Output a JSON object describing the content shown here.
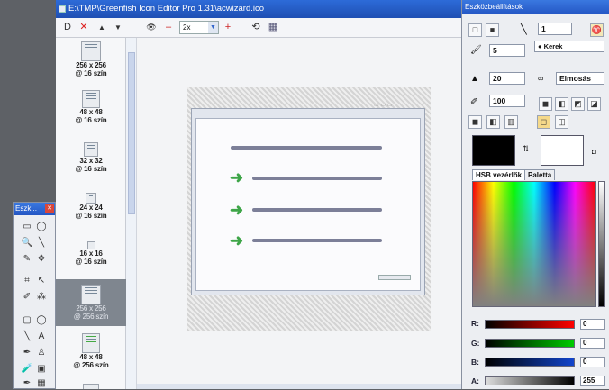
{
  "window": {
    "title": "E:\\TMP\\Greenfish Icon Editor Pro 1.31\\acwizard.ico"
  },
  "toolbar": {
    "new": "D",
    "close": "✕",
    "up": "▲",
    "down": "▼",
    "eye": "👁",
    "minus": "–",
    "zoom": "2x",
    "plus": "+",
    "icon_a": "⟲",
    "icon_b": "▦"
  },
  "thumbnails": [
    {
      "size": "256 x 256",
      "colors": "@ 16 szín"
    },
    {
      "size": "48 x 48",
      "colors": "@ 16 szín"
    },
    {
      "size": "32 x 32",
      "colors": "@ 16 szín"
    },
    {
      "size": "24 x 24",
      "colors": "@ 16 szín"
    },
    {
      "size": "16 x 16",
      "colors": "@ 16 szín"
    },
    {
      "size": "256 x 256",
      "colors": "@ 256 szín"
    },
    {
      "size": "48 x 48",
      "colors": "@ 256 szín"
    }
  ],
  "tools": {
    "title": "Eszk...",
    "close": "✕",
    "icons": [
      "▭",
      "◯",
      "🔍",
      "╲",
      "✎",
      "✥",
      "⌗",
      "↖",
      "✐",
      "⁂",
      "▢",
      "◯",
      "╲",
      "A",
      "✒",
      "♙",
      "🧪",
      "▣",
      "✒",
      "▦"
    ]
  },
  "props": {
    "title": "Eszközbeállítások",
    "line_width": "1",
    "size": "5",
    "shape": "● Kerek",
    "opacity": "20",
    "blend": "Elmosás",
    "hardness": "100",
    "tabs": {
      "hsb": "HSB vezérlők",
      "palette": "Paletta"
    },
    "rgba": [
      {
        "label": "R:",
        "value": "0"
      },
      {
        "label": "G:",
        "value": "0"
      },
      {
        "label": "B:",
        "value": "0"
      },
      {
        "label": "A:",
        "value": "255"
      }
    ],
    "colors": {
      "foreground": "#000000",
      "background": "#ffffff"
    }
  }
}
